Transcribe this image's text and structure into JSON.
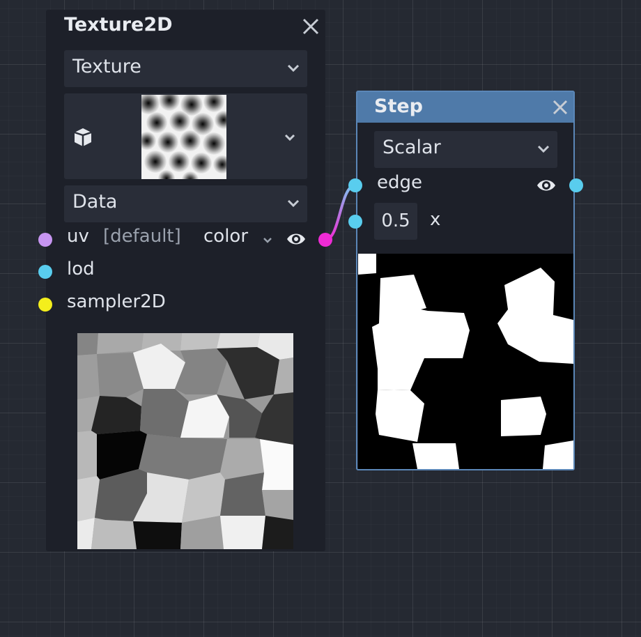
{
  "texture_node": {
    "title": "Texture2D",
    "source_dropdown": {
      "selected": "Texture"
    },
    "data_dropdown": {
      "selected": "Data"
    },
    "ports": {
      "uv": "uv",
      "uv_default": "[default]",
      "lod": "lod",
      "sampler": "sampler2D"
    },
    "output": {
      "selected": "color"
    },
    "icons": [
      "cube-icon",
      "chevron-down-icon",
      "eye-icon",
      "close-icon"
    ]
  },
  "step_node": {
    "title": "Step",
    "type_dropdown": {
      "selected": "Scalar"
    },
    "ports": {
      "edge": "edge",
      "x": "x"
    },
    "x_value": "0.5"
  },
  "colors": {
    "uv_port": "#c795f1",
    "lod_port": "#59cdee",
    "sampler_port": "#f4ee1c",
    "color_output_port": "#ef2bd5",
    "step_header": "#4f7aa9",
    "step_border": "#5b87b8"
  }
}
